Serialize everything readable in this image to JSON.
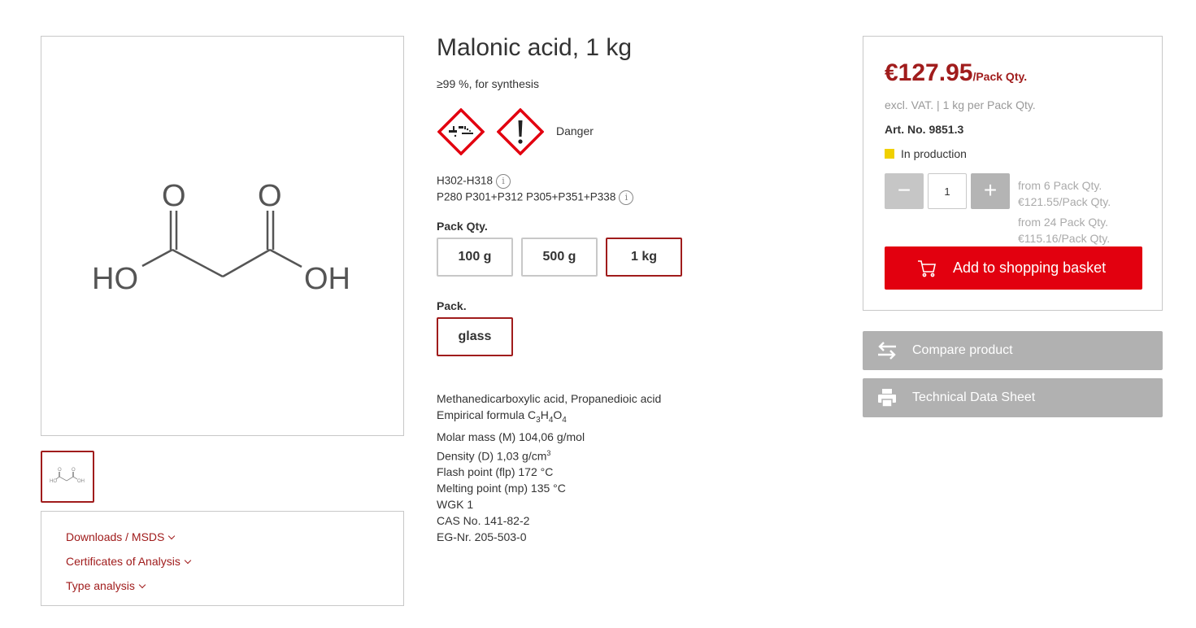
{
  "product": {
    "title": "Malonic acid, 1 kg",
    "subtitle": "≥99 %, for synthesis",
    "signal_word": "Danger",
    "hazard_statements": "H302-H318",
    "precautionary_statements": "P280 P301+P312 P305+P351+P338",
    "info_icon_glyph": "i",
    "hazard_pictograms": [
      "ghs05-corrosive-icon",
      "ghs07-exclamation-icon"
    ],
    "structure_labels": {
      "o_left": "O",
      "o_right": "O",
      "ho": "HO",
      "oh": "OH"
    }
  },
  "options": {
    "pack_qty_label": "Pack Qty.",
    "pack_qty": [
      {
        "label": "100 g",
        "selected": false
      },
      {
        "label": "500 g",
        "selected": false
      },
      {
        "label": "1 kg",
        "selected": true
      }
    ],
    "pack_label": "Pack.",
    "pack": [
      {
        "label": "glass",
        "selected": true
      }
    ]
  },
  "properties": {
    "synonyms": "Methanedicarboxylic acid, Propanedioic acid",
    "formula_prefix": "Empirical formula C",
    "formula_c": "3",
    "formula_h": "H",
    "formula_h_sub": "4",
    "formula_o": "O",
    "formula_o_sub": "4",
    "molar_mass": "Molar mass (M) 104,06 g/mol",
    "density_prefix": "Density (D) 1,03 g/cm",
    "density_sup": "3",
    "flash_point": "Flash point (flp) 172 °C",
    "melting_point": "Melting point (mp) 135 °C",
    "wgk": "WGK 1",
    "cas": "CAS No. 141-82-2",
    "eg": "EG-Nr. 205-503-0"
  },
  "downloads": {
    "items": [
      "Downloads / MSDS",
      "Certificates of Analysis",
      "Type analysis"
    ]
  },
  "buy": {
    "price": "€127.95",
    "price_unit": "/Pack Qty.",
    "vat_note": "excl. VAT. | 1 kg per Pack Qty.",
    "art_no": "Art. No. 9851.3",
    "status": "In production",
    "status_color": "#f0d000",
    "qty_minus": "−",
    "qty_plus": "+",
    "qty_value": "1",
    "tiers": [
      {
        "from": "from 6 Pack Qty.",
        "price": "€121.55/Pack Qty."
      },
      {
        "from": "from 24 Pack Qty.",
        "price": "€115.16/Pack Qty."
      }
    ],
    "add_to_basket": "Add to shopping basket",
    "accent_color": "#e2000f",
    "price_color": "#a01c1c"
  },
  "actions": {
    "compare": "Compare product",
    "tds": "Technical Data Sheet"
  }
}
